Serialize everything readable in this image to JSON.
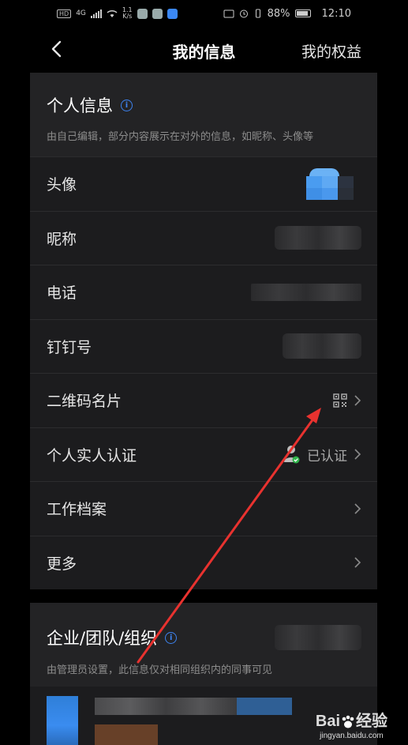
{
  "status_bar": {
    "hd_label": "HD",
    "net_type": "4G",
    "speed_value": "1.1",
    "speed_unit": "K/s",
    "battery_percent": "88%",
    "time": "12:10",
    "battery_level": 0.88
  },
  "header": {
    "title": "我的信息",
    "right_link": "我的权益"
  },
  "personal_info": {
    "title": "个人信息",
    "description": "由自己编辑，部分内容展示在对外的信息，如昵称、头像等",
    "rows": [
      {
        "label": "头像"
      },
      {
        "label": "昵称"
      },
      {
        "label": "电话"
      },
      {
        "label": "钉钉号"
      },
      {
        "label": "二维码名片"
      },
      {
        "label": "个人实人认证",
        "status": "已认证"
      },
      {
        "label": "工作档案"
      },
      {
        "label": "更多"
      }
    ]
  },
  "organization": {
    "title": "企业/团队/组织",
    "description": "由管理员设置，此信息仅对相同组织内的同事可见"
  },
  "watermark": {
    "brand_left": "Bai",
    "brand_right": "经验",
    "url": "jingyan.baidu.com"
  },
  "colors": {
    "accent_blue": "#3d83f0",
    "arrow_red": "#e8322f",
    "verified_green": "#2fb34a"
  }
}
